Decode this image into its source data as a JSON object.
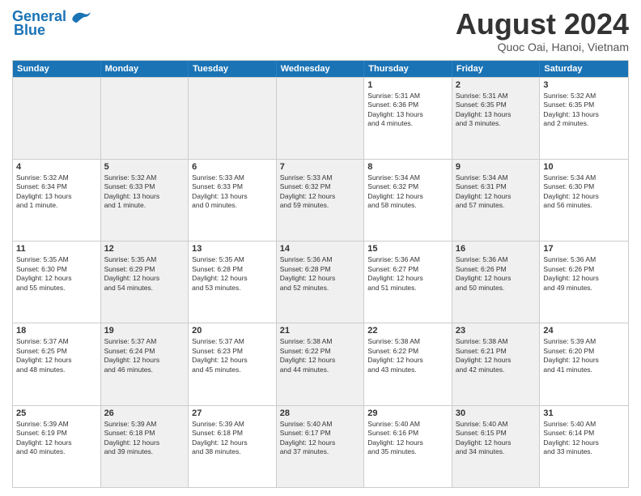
{
  "header": {
    "logo_general": "General",
    "logo_blue": "Blue",
    "title": "August 2024",
    "location": "Quoc Oai, Hanoi, Vietnam"
  },
  "weekdays": [
    "Sunday",
    "Monday",
    "Tuesday",
    "Wednesday",
    "Thursday",
    "Friday",
    "Saturday"
  ],
  "rows": [
    [
      {
        "day": "",
        "info": "",
        "shaded": true
      },
      {
        "day": "",
        "info": "",
        "shaded": true
      },
      {
        "day": "",
        "info": "",
        "shaded": true
      },
      {
        "day": "",
        "info": "",
        "shaded": true
      },
      {
        "day": "1",
        "info": "Sunrise: 5:31 AM\nSunset: 6:36 PM\nDaylight: 13 hours\nand 4 minutes."
      },
      {
        "day": "2",
        "info": "Sunrise: 5:31 AM\nSunset: 6:35 PM\nDaylight: 13 hours\nand 3 minutes.",
        "shaded": true
      },
      {
        "day": "3",
        "info": "Sunrise: 5:32 AM\nSunset: 6:35 PM\nDaylight: 13 hours\nand 2 minutes."
      }
    ],
    [
      {
        "day": "4",
        "info": "Sunrise: 5:32 AM\nSunset: 6:34 PM\nDaylight: 13 hours\nand 1 minute."
      },
      {
        "day": "5",
        "info": "Sunrise: 5:32 AM\nSunset: 6:33 PM\nDaylight: 13 hours\nand 1 minute.",
        "shaded": true
      },
      {
        "day": "6",
        "info": "Sunrise: 5:33 AM\nSunset: 6:33 PM\nDaylight: 13 hours\nand 0 minutes."
      },
      {
        "day": "7",
        "info": "Sunrise: 5:33 AM\nSunset: 6:32 PM\nDaylight: 12 hours\nand 59 minutes.",
        "shaded": true
      },
      {
        "day": "8",
        "info": "Sunrise: 5:34 AM\nSunset: 6:32 PM\nDaylight: 12 hours\nand 58 minutes."
      },
      {
        "day": "9",
        "info": "Sunrise: 5:34 AM\nSunset: 6:31 PM\nDaylight: 12 hours\nand 57 minutes.",
        "shaded": true
      },
      {
        "day": "10",
        "info": "Sunrise: 5:34 AM\nSunset: 6:30 PM\nDaylight: 12 hours\nand 56 minutes."
      }
    ],
    [
      {
        "day": "11",
        "info": "Sunrise: 5:35 AM\nSunset: 6:30 PM\nDaylight: 12 hours\nand 55 minutes."
      },
      {
        "day": "12",
        "info": "Sunrise: 5:35 AM\nSunset: 6:29 PM\nDaylight: 12 hours\nand 54 minutes.",
        "shaded": true
      },
      {
        "day": "13",
        "info": "Sunrise: 5:35 AM\nSunset: 6:28 PM\nDaylight: 12 hours\nand 53 minutes."
      },
      {
        "day": "14",
        "info": "Sunrise: 5:36 AM\nSunset: 6:28 PM\nDaylight: 12 hours\nand 52 minutes.",
        "shaded": true
      },
      {
        "day": "15",
        "info": "Sunrise: 5:36 AM\nSunset: 6:27 PM\nDaylight: 12 hours\nand 51 minutes."
      },
      {
        "day": "16",
        "info": "Sunrise: 5:36 AM\nSunset: 6:26 PM\nDaylight: 12 hours\nand 50 minutes.",
        "shaded": true
      },
      {
        "day": "17",
        "info": "Sunrise: 5:36 AM\nSunset: 6:26 PM\nDaylight: 12 hours\nand 49 minutes."
      }
    ],
    [
      {
        "day": "18",
        "info": "Sunrise: 5:37 AM\nSunset: 6:25 PM\nDaylight: 12 hours\nand 48 minutes."
      },
      {
        "day": "19",
        "info": "Sunrise: 5:37 AM\nSunset: 6:24 PM\nDaylight: 12 hours\nand 46 minutes.",
        "shaded": true
      },
      {
        "day": "20",
        "info": "Sunrise: 5:37 AM\nSunset: 6:23 PM\nDaylight: 12 hours\nand 45 minutes."
      },
      {
        "day": "21",
        "info": "Sunrise: 5:38 AM\nSunset: 6:22 PM\nDaylight: 12 hours\nand 44 minutes.",
        "shaded": true
      },
      {
        "day": "22",
        "info": "Sunrise: 5:38 AM\nSunset: 6:22 PM\nDaylight: 12 hours\nand 43 minutes."
      },
      {
        "day": "23",
        "info": "Sunrise: 5:38 AM\nSunset: 6:21 PM\nDaylight: 12 hours\nand 42 minutes.",
        "shaded": true
      },
      {
        "day": "24",
        "info": "Sunrise: 5:39 AM\nSunset: 6:20 PM\nDaylight: 12 hours\nand 41 minutes."
      }
    ],
    [
      {
        "day": "25",
        "info": "Sunrise: 5:39 AM\nSunset: 6:19 PM\nDaylight: 12 hours\nand 40 minutes."
      },
      {
        "day": "26",
        "info": "Sunrise: 5:39 AM\nSunset: 6:18 PM\nDaylight: 12 hours\nand 39 minutes.",
        "shaded": true
      },
      {
        "day": "27",
        "info": "Sunrise: 5:39 AM\nSunset: 6:18 PM\nDaylight: 12 hours\nand 38 minutes."
      },
      {
        "day": "28",
        "info": "Sunrise: 5:40 AM\nSunset: 6:17 PM\nDaylight: 12 hours\nand 37 minutes.",
        "shaded": true
      },
      {
        "day": "29",
        "info": "Sunrise: 5:40 AM\nSunset: 6:16 PM\nDaylight: 12 hours\nand 35 minutes."
      },
      {
        "day": "30",
        "info": "Sunrise: 5:40 AM\nSunset: 6:15 PM\nDaylight: 12 hours\nand 34 minutes.",
        "shaded": true
      },
      {
        "day": "31",
        "info": "Sunrise: 5:40 AM\nSunset: 6:14 PM\nDaylight: 12 hours\nand 33 minutes."
      }
    ]
  ]
}
